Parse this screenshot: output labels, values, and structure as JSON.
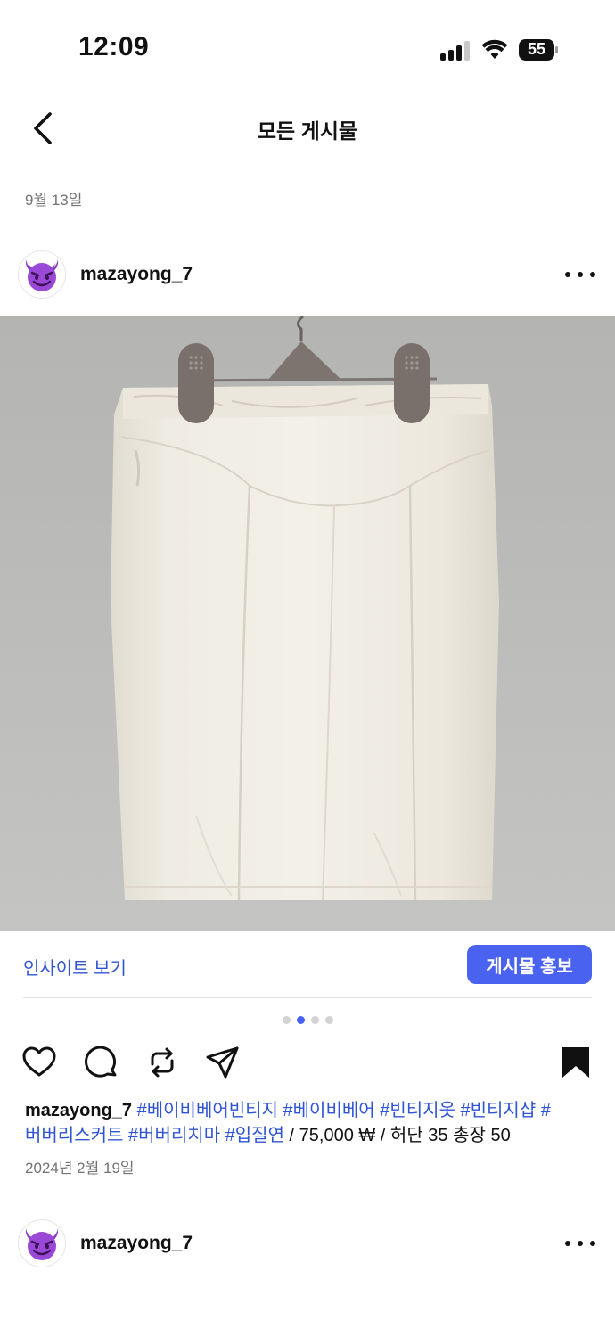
{
  "status": {
    "time": "12:09",
    "battery": "55"
  },
  "nav": {
    "title": "모든 게시물"
  },
  "feed": {
    "section_date": "9월 13일"
  },
  "post": {
    "username": "mazayong_7",
    "insight_link": "인사이트 보기",
    "promote_button": "게시물 홍보",
    "carousel": {
      "count": 4,
      "active_index": 1
    },
    "caption": {
      "username": "mazayong_7",
      "hashtags": [
        "#베이비베어빈티지",
        "#베이비베어",
        "#빈티지옷",
        "#빈티지샵",
        "#버버리스커트",
        "#버버리치마",
        "#입질연"
      ],
      "details": "/ 75,000 ₩ / 허단 35 총장 50"
    },
    "date": "2024년 2월 19일"
  },
  "next_post": {
    "username": "mazayong_7"
  },
  "icons": {
    "avatar": "smiling-devil-emoji",
    "back": "chevron-left-icon",
    "more": "more-horizontal-icon",
    "like": "heart-icon",
    "comment": "comment-icon",
    "repost": "repost-icon",
    "share": "send-icon",
    "save": "bookmark-icon"
  },
  "colors": {
    "link": "#2f55d4",
    "promote_button": "#4a62f0",
    "avatar_purple": "#8a3cc8"
  }
}
